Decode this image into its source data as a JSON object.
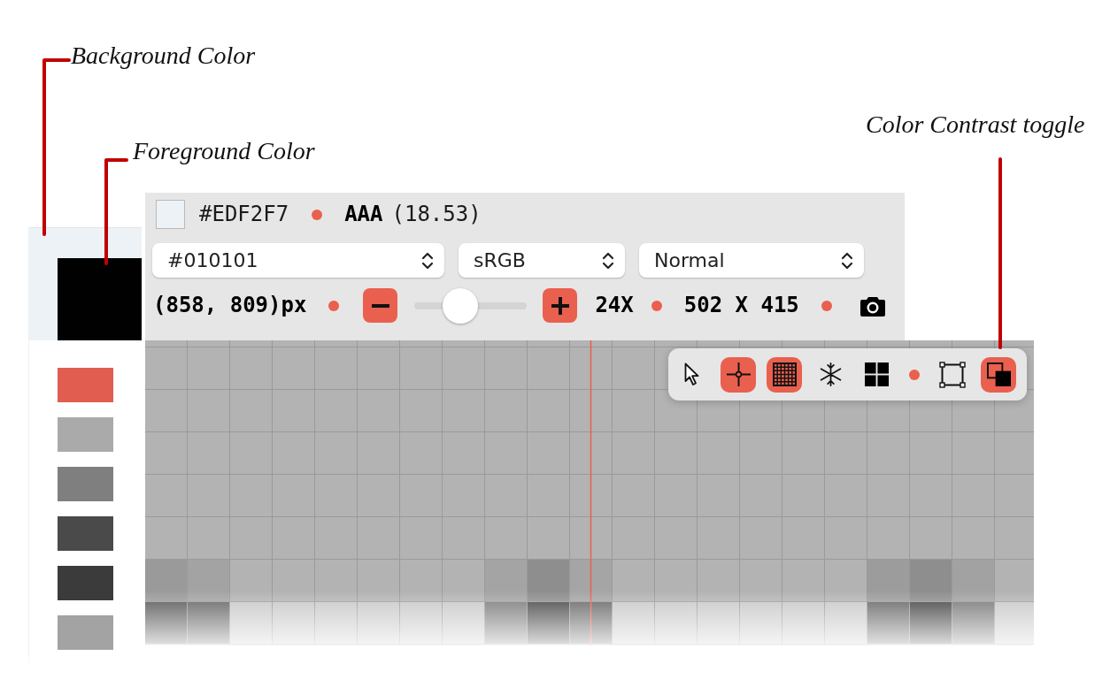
{
  "annotations": [
    {
      "text": "Background Color"
    },
    {
      "text": "Foreground Color"
    },
    {
      "text": "Color Contrast toggle"
    }
  ],
  "sidebar": {
    "previews": [
      {
        "color": "#edf2f7"
      },
      {
        "color": "#010101"
      }
    ],
    "palette": [
      {
        "color": "#e05d50"
      },
      {
        "color": "#aaaaaa"
      },
      {
        "color": "#7f7f7f"
      },
      {
        "color": "#4a4a4a"
      },
      {
        "color": "#3b3b3b"
      },
      {
        "color": "#a3a3a3"
      }
    ]
  },
  "inspector": {
    "contrast": {
      "color": "#edf2f7",
      "hex": "#EDF2F7",
      "rating": "AAA",
      "ratio": "(18.53)"
    },
    "selects": [
      {
        "value": "#010101"
      },
      {
        "value": "sRGB"
      },
      {
        "value": "Normal"
      }
    ],
    "status": {
      "position": "(858, 809)px",
      "zoom": {
        "level": 0.36
      },
      "zoom_factor": "24X",
      "size": "502 X 415"
    }
  },
  "toolbar": {
    "groups": [
      {
        "tools": [
          {
            "selected": false
          },
          {
            "selected": true
          },
          {
            "selected": true
          },
          {
            "selected": false
          },
          {
            "selected": false
          }
        ]
      },
      {
        "tools": [
          {
            "selected": false
          },
          {
            "selected": true
          }
        ]
      }
    ]
  }
}
